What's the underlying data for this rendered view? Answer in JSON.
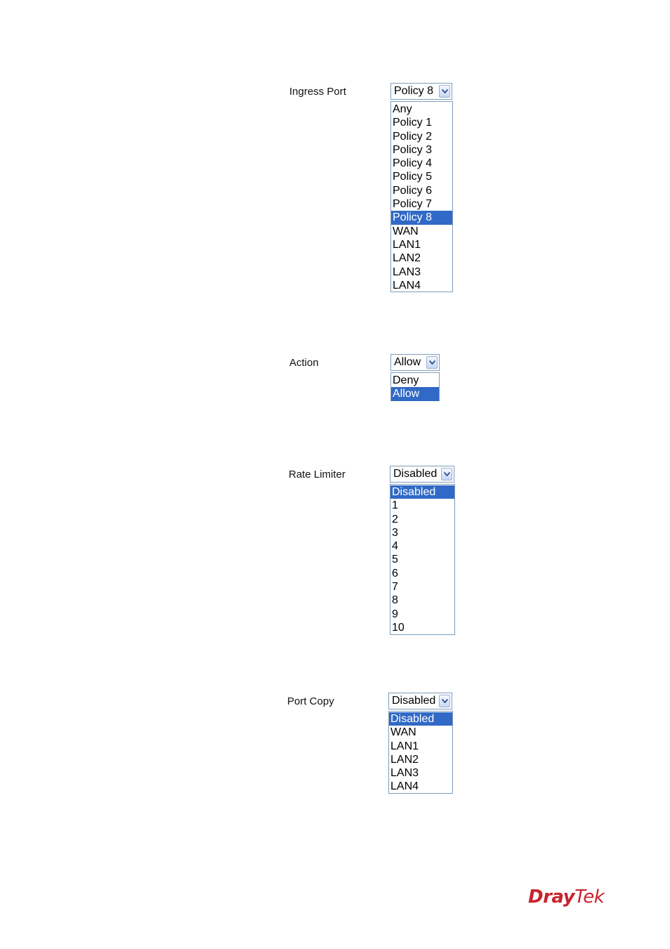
{
  "ingress_port": {
    "label": "Ingress Port",
    "selected": "Policy 8",
    "options": [
      "Any",
      "Policy 1",
      "Policy 2",
      "Policy 3",
      "Policy 4",
      "Policy 5",
      "Policy 6",
      "Policy 7",
      "Policy 8",
      "WAN",
      "LAN1",
      "LAN2",
      "LAN3",
      "LAN4"
    ],
    "highlighted_index": 8
  },
  "action": {
    "label": "Action",
    "selected": "Allow",
    "options": [
      "Deny",
      "Allow"
    ],
    "highlighted_index": 1
  },
  "rate_limiter": {
    "label": "Rate Limiter",
    "selected": "Disabled",
    "options": [
      "Disabled",
      "1",
      "2",
      "3",
      "4",
      "5",
      "6",
      "7",
      "8",
      "9",
      "10"
    ],
    "highlighted_index": 0
  },
  "port_copy": {
    "label": "Port Copy",
    "selected": "Disabled",
    "options": [
      "Disabled",
      "WAN",
      "LAN1",
      "LAN2",
      "LAN3",
      "LAN4"
    ],
    "highlighted_index": 0
  },
  "logo": {
    "part_a": "Dray",
    "part_b": "Tek",
    "color": "#c8232c"
  },
  "colors": {
    "highlight": "#3169c6",
    "border": "#7f9db9"
  }
}
